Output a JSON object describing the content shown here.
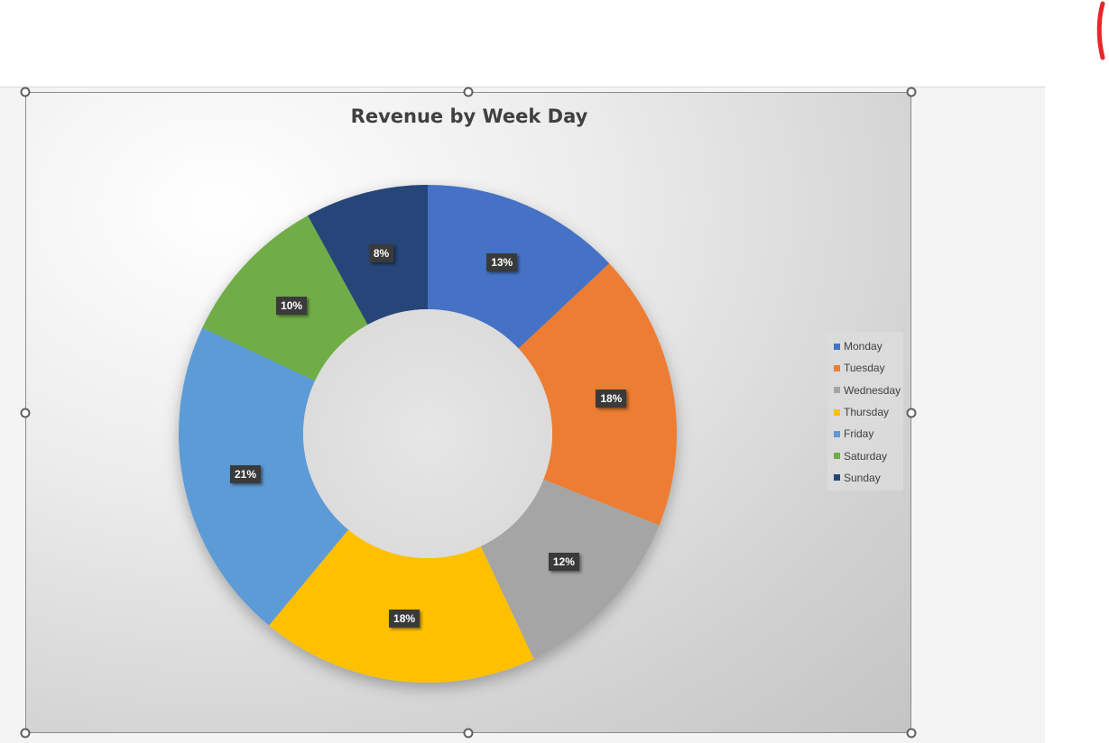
{
  "chart_data": {
    "type": "pie",
    "title": "Revenue by Week Day",
    "categories": [
      "Monday",
      "Tuesday",
      "Wednesday",
      "Thursday",
      "Friday",
      "Saturday",
      "Sunday"
    ],
    "values": [
      13,
      18,
      12,
      18,
      21,
      10,
      8
    ],
    "data_labels": [
      "13%",
      "18%",
      "12%",
      "18%",
      "21%",
      "10%",
      "8%"
    ],
    "colors": [
      "#4472C4",
      "#ED7D31",
      "#A5A5A5",
      "#FFC000",
      "#5B9BD5",
      "#70AD47",
      "#264478"
    ],
    "legend_position": "right",
    "donut": true
  },
  "colors": {
    "ink_mark": "#e8262a"
  }
}
